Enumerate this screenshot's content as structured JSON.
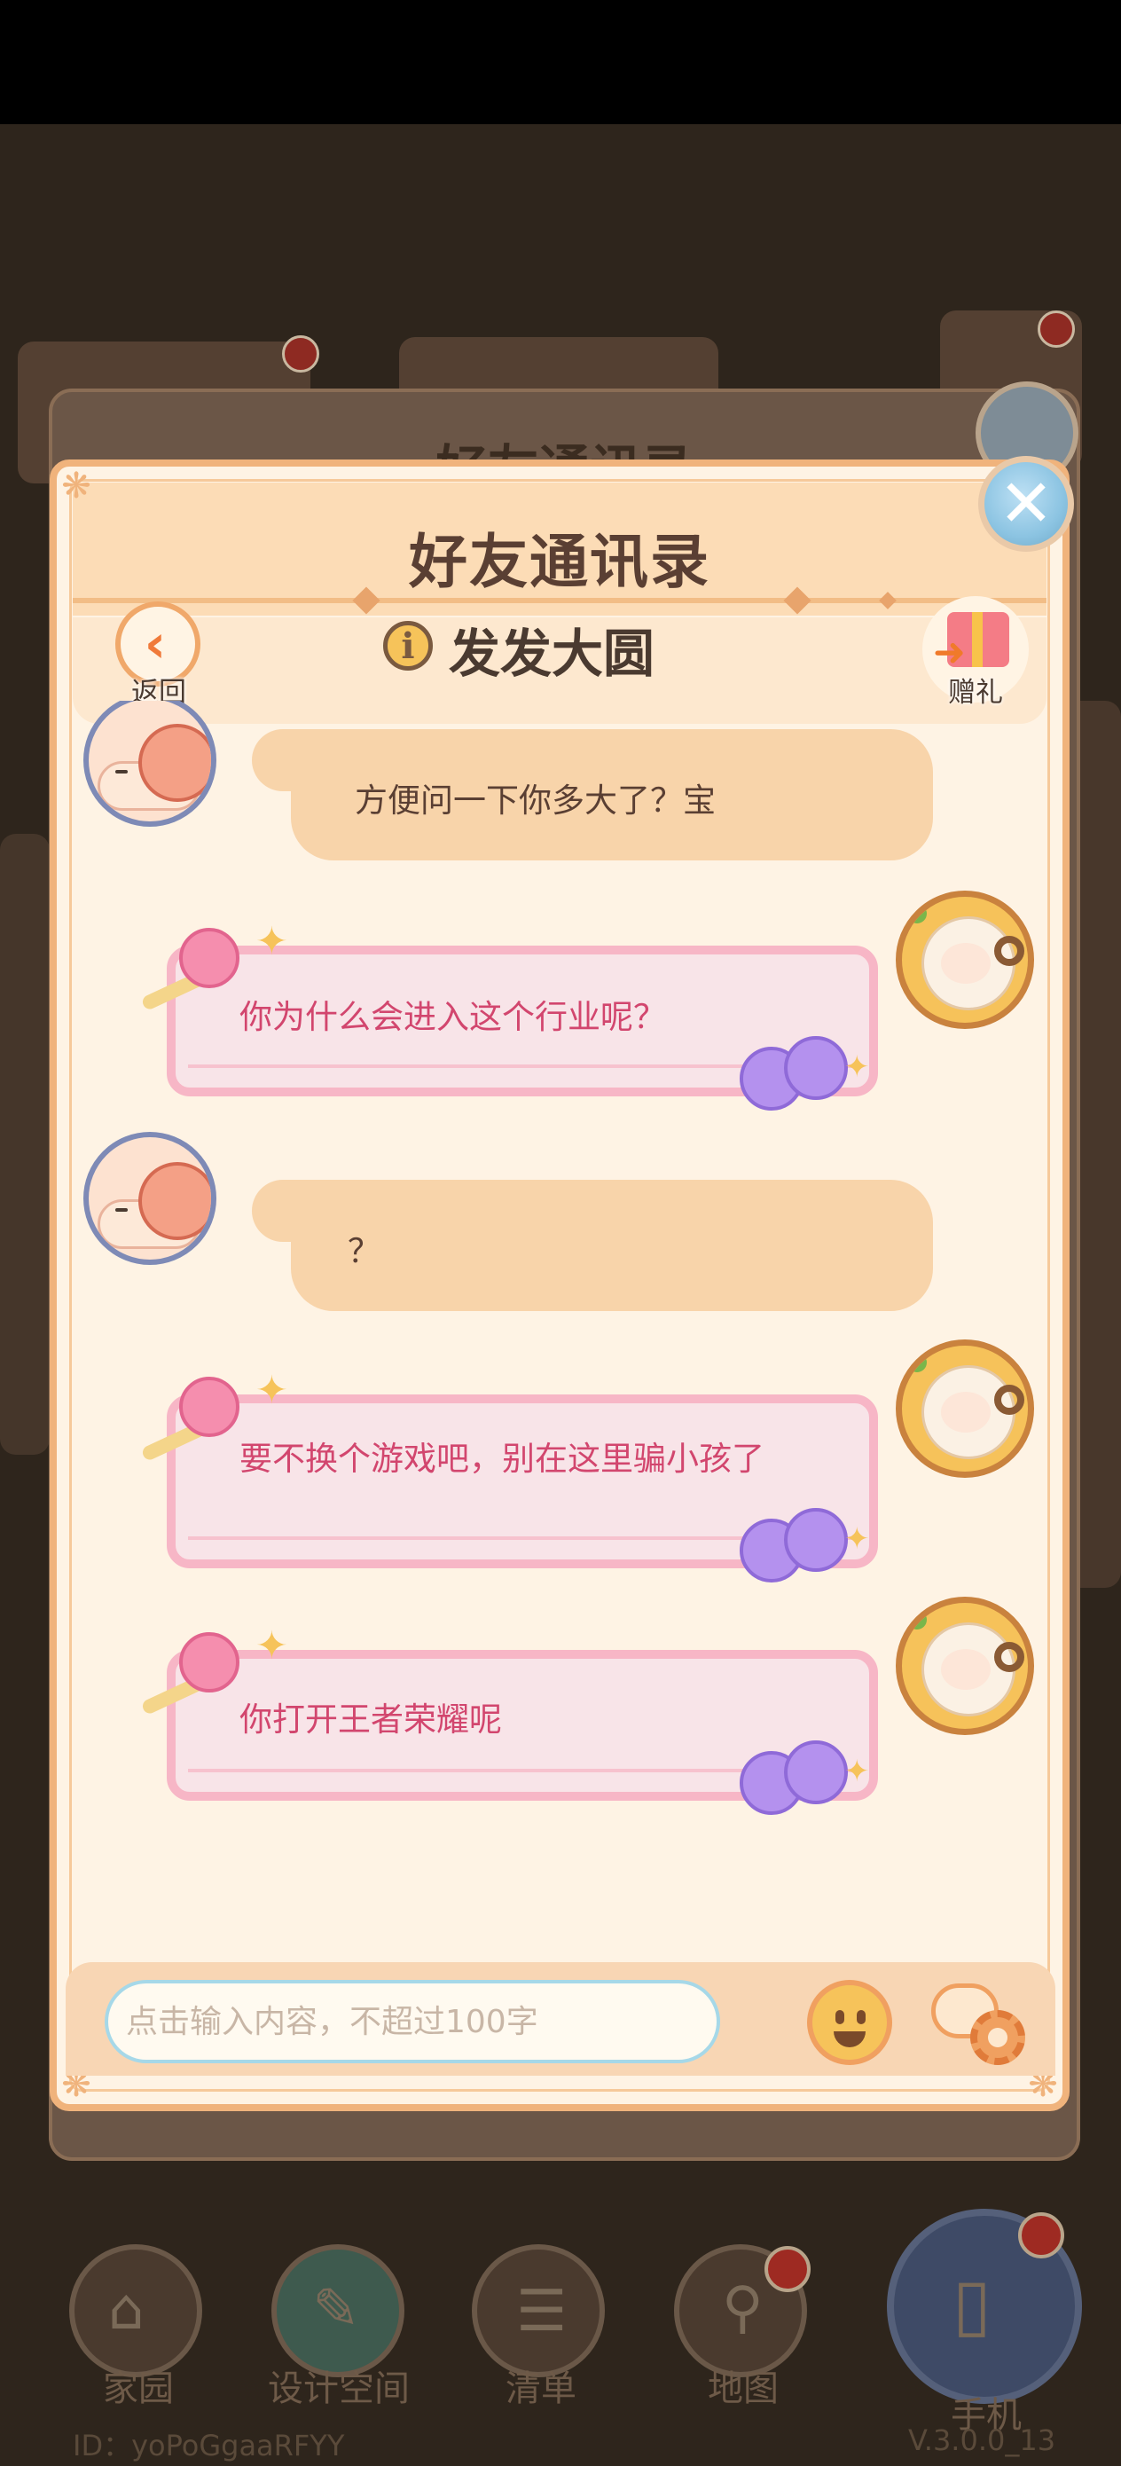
{
  "dialog": {
    "title": "好友通讯录",
    "back_label": "返回",
    "friend_name": "发发大圆",
    "gift_label": "赠礼"
  },
  "messages": [
    {
      "sender": "friend",
      "text": "方便问一下你多大了？宝"
    },
    {
      "sender": "me",
      "text": "你为什么会进入这个行业呢？"
    },
    {
      "sender": "friend",
      "text": "？"
    },
    {
      "sender": "me",
      "text": "要不换个游戏吧，别在这里骗小孩了"
    },
    {
      "sender": "me",
      "text": "你打开王者荣耀呢"
    }
  ],
  "input": {
    "placeholder": "点击输入内容，不超过100字"
  },
  "background": {
    "dialog_title": "好友通讯录",
    "nav": [
      {
        "label": "家园",
        "icon": "house-icon"
      },
      {
        "label": "设计空间",
        "icon": "design-icon"
      },
      {
        "label": "清单",
        "icon": "list-icon"
      },
      {
        "label": "地图",
        "icon": "map-pin-icon"
      },
      {
        "label": "手机",
        "icon": "phone-icon"
      }
    ],
    "player_id": "ID：yoPoGgaaRFYY",
    "version": "V.3.0.0_13"
  },
  "colors": {
    "dialog_bg": "#fef3e4",
    "dialog_border": "#f0b37c",
    "friend_bubble": "#f8d4aa",
    "my_bubble_border": "#f7b6c6",
    "my_text": "#d2466e"
  }
}
